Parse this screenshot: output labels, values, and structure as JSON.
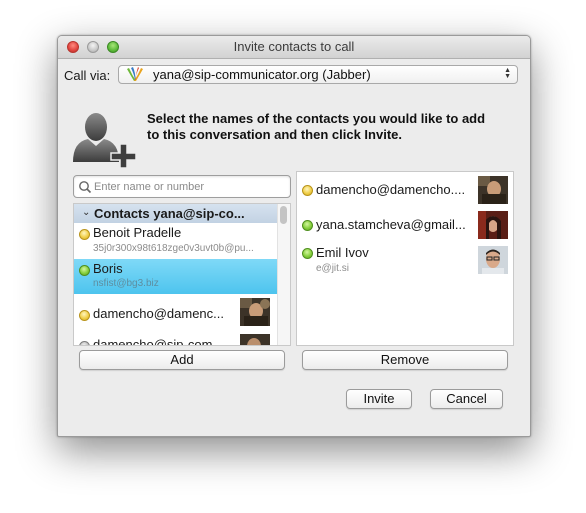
{
  "window": {
    "title": "Invite contacts to call"
  },
  "call_via": {
    "label": "Call via:",
    "selected": "yana@sip-communicator.org (Jabber)",
    "icon": "jabber-icon"
  },
  "instruction": "Select the names of the contacts you would like to add to this conversation and then click Invite.",
  "search": {
    "placeholder": "Enter name or number",
    "value": ""
  },
  "contacts_list": {
    "group_label": "Contacts yana@sip-co...",
    "items": [
      {
        "name": "Benoit Pradelle",
        "subtitle": "35j0r300x98t618zge0v3uvt0b@pu...",
        "status": "away"
      },
      {
        "name": "Boris",
        "subtitle": "nsfist@bg3.biz",
        "status": "online",
        "selected": true
      },
      {
        "name": "damencho@damenc...",
        "subtitle": "",
        "status": "away"
      },
      {
        "name": "damencho@sip-com...",
        "subtitle": "",
        "status": "offline"
      }
    ]
  },
  "invited_list": {
    "items": [
      {
        "name": "damencho@damencho....",
        "subtitle": "",
        "status": "away"
      },
      {
        "name": "yana.stamcheva@gmail...",
        "subtitle": "",
        "status": "online"
      },
      {
        "name": "Emil Ivov",
        "subtitle": "e@jit.si",
        "status": "online"
      }
    ]
  },
  "buttons": {
    "add": "Add",
    "remove": "Remove",
    "invite": "Invite",
    "cancel": "Cancel"
  },
  "colors": {
    "selection": "#4dc4ee",
    "group_header": "#c9d8e8",
    "status_away": "#f0cf4a",
    "status_online": "#86cf3c"
  }
}
